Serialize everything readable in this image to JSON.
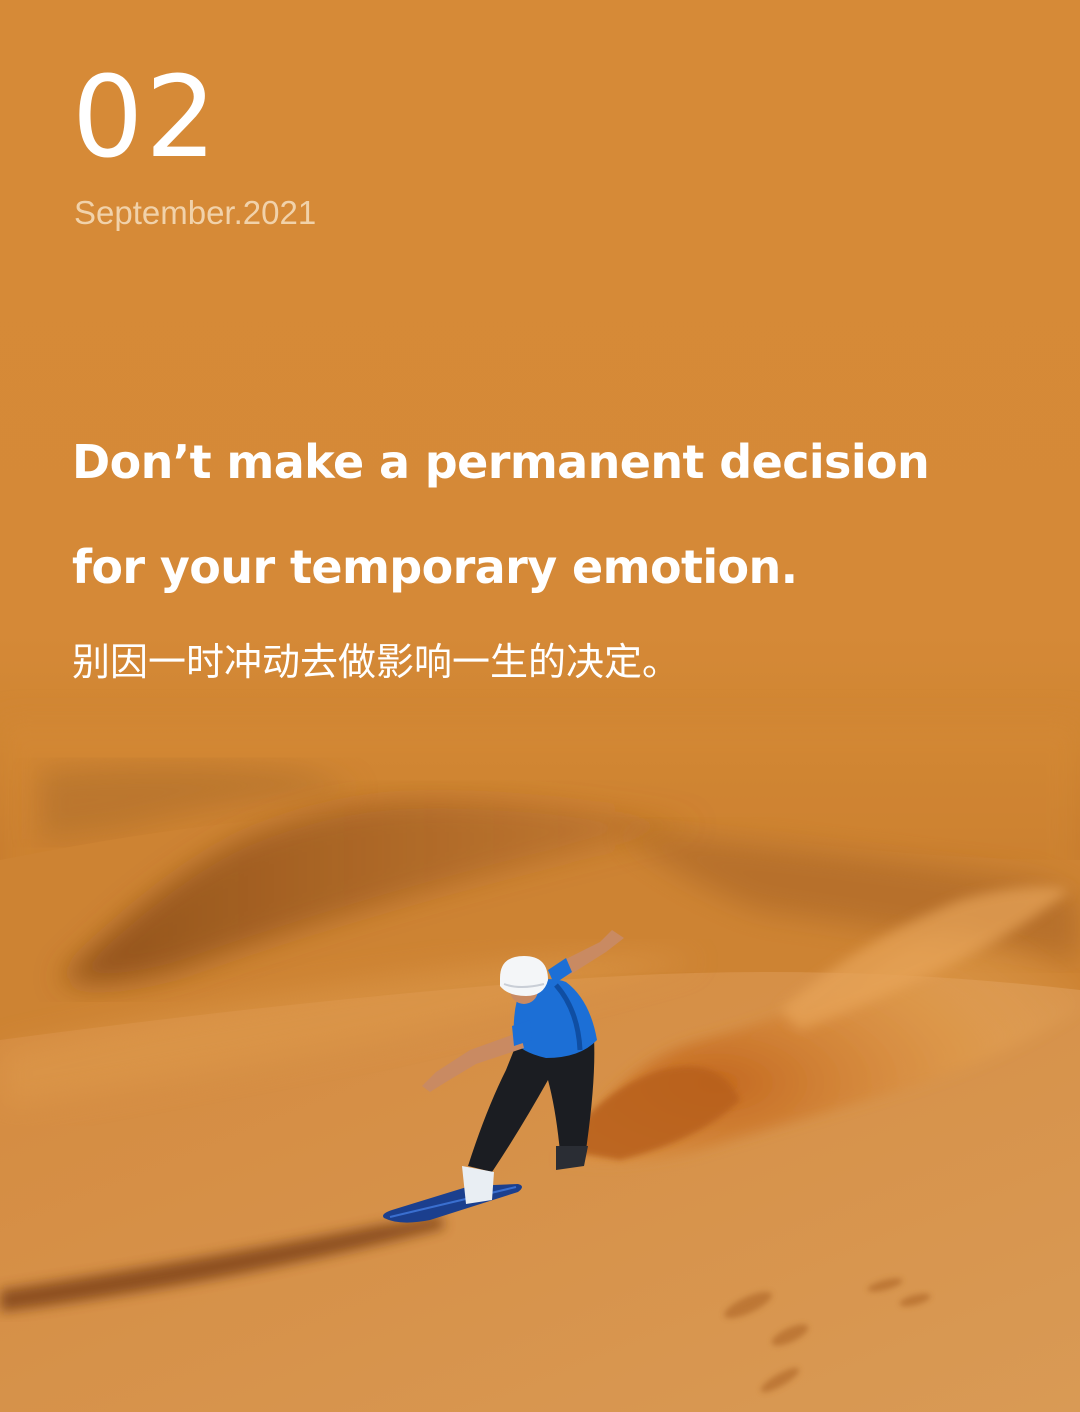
{
  "issue": {
    "number": "02",
    "date": "September.2021"
  },
  "quote": {
    "english_line_1": "Don’t make a permanent decision",
    "english_line_2": "for your temporary emotion.",
    "chinese": "别因一时冲动去做影响一生的决定。"
  },
  "colors": {
    "background": "#d68a37",
    "text": "#ffffff",
    "date_text": "#f1d2aa",
    "sand": "#c9792c",
    "shirt": "#1c6fd6",
    "board": "#1b3f8e"
  }
}
